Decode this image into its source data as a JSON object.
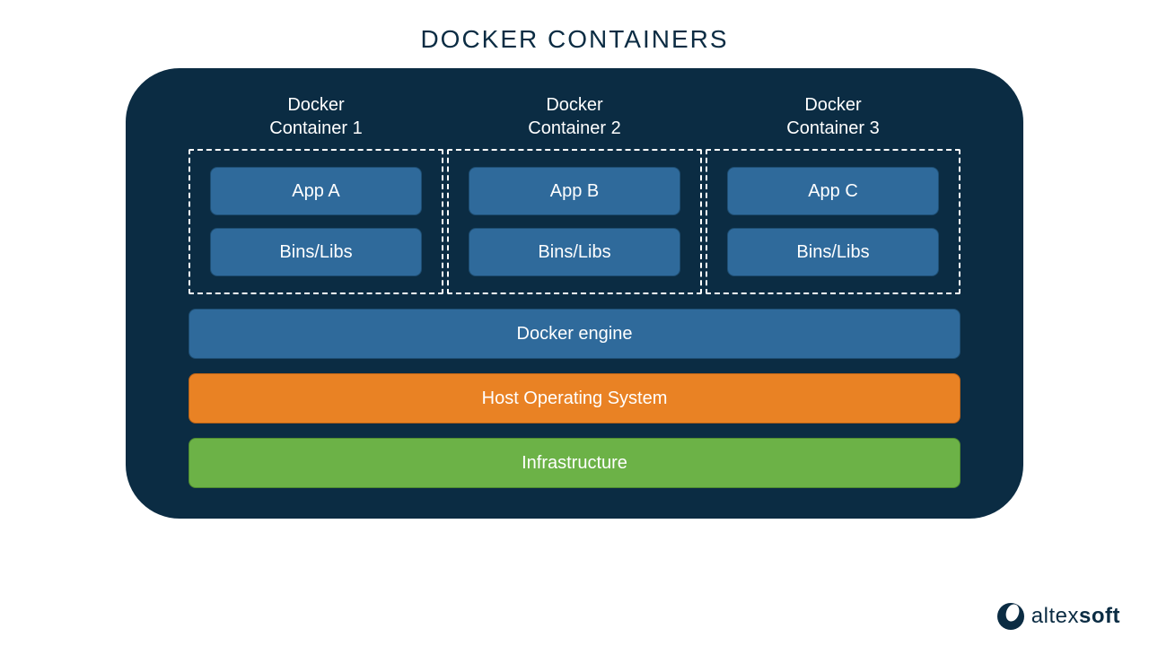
{
  "title": "DOCKER CONTAINERS",
  "containers": [
    {
      "label": "Docker\nContainer 1",
      "app": "App A",
      "libs": "Bins/Libs"
    },
    {
      "label": "Docker\nContainer 2",
      "app": "App B",
      "libs": "Bins/Libs"
    },
    {
      "label": "Docker\nContainer 3",
      "app": "App C",
      "libs": "Bins/Libs"
    }
  ],
  "layers": {
    "engine": "Docker engine",
    "host_os": "Host Operating System",
    "infra": "Infrastructure"
  },
  "brand": {
    "part1": "altex",
    "part2": "soft"
  },
  "colors": {
    "panel_bg": "#0b2c43",
    "blue": "#2f6a9b",
    "orange": "#e98224",
    "green": "#6cb247"
  }
}
